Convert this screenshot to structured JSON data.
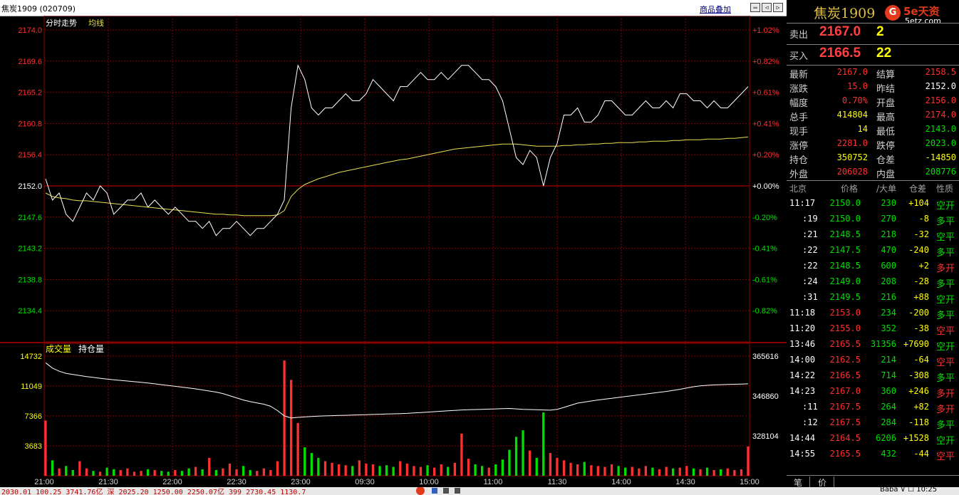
{
  "header": {
    "title": "焦炭1909 (020709)",
    "overlay_link": "商品叠加"
  },
  "chart_labels": {
    "tick_legend": "分时走势",
    "avg_legend": "均线",
    "volume_legend": "成交量",
    "oi_legend": "持仓量"
  },
  "colors": {
    "up": "#ff3030",
    "down": "#00e000",
    "flat": "#ffffff",
    "grid": "#8b0000",
    "price_line": "#ffffff",
    "avg_line": "#e8e050",
    "volume_label": "#ffff00"
  },
  "chart_data": {
    "type": "line",
    "price_axis": {
      "ticks": [
        "2174.0",
        "2169.6",
        "2165.2",
        "2160.8",
        "2156.4",
        "2152.0",
        "2147.6",
        "2143.2",
        "2138.8",
        "2134.4"
      ],
      "pct_ticks": [
        "+1.02%",
        "+0.82%",
        "+0.61%",
        "+0.41%",
        "+0.20%",
        "+0.00%",
        "-0.20%",
        "-0.41%",
        "-0.61%",
        "-0.82%"
      ],
      "prev_settle": 2152.0,
      "ylim": [
        2130.0,
        2174.0
      ]
    },
    "volume_axis": {
      "ticks": [
        "14732",
        "11049",
        "7366",
        "3683"
      ],
      "oi_ticks": [
        "365616",
        "346860",
        "328104"
      ],
      "ylim": [
        0,
        14732
      ],
      "oi_lim": [
        309348,
        365616
      ]
    },
    "time_labels": [
      "21:00",
      "21:30",
      "22:00",
      "22:30",
      "23:00",
      "09:30",
      "10:00",
      "11:00",
      "11:30",
      "14:00",
      "14:30",
      "15:00"
    ],
    "price": [
      2153,
      2150,
      2151,
      2148,
      2147,
      2149,
      2151,
      2150,
      2152,
      2151,
      2148,
      2149,
      2150,
      2150,
      2151,
      2149,
      2150,
      2149,
      2148,
      2149,
      2148,
      2147,
      2147,
      2146,
      2147,
      2145,
      2146,
      2146,
      2147,
      2146,
      2145,
      2146,
      2146,
      2147,
      2148,
      2150,
      2163,
      2169,
      2167,
      2163,
      2162,
      2163,
      2163,
      2164,
      2165,
      2164,
      2164,
      2165,
      2167,
      2166,
      2165,
      2164,
      2166,
      2166,
      2167,
      2168,
      2167,
      2167,
      2168,
      2167,
      2168,
      2169,
      2169,
      2168,
      2167,
      2167,
      2166,
      2164,
      2160,
      2156,
      2155,
      2157,
      2156,
      2152,
      2156,
      2158,
      2162,
      2162,
      2163,
      2161,
      2161,
      2162,
      2164,
      2164,
      2163,
      2162,
      2162,
      2163,
      2164,
      2163,
      2163,
      2164,
      2163,
      2165,
      2165,
      2164,
      2164,
      2163,
      2164,
      2163,
      2163,
      2164,
      2165,
      2166
    ],
    "avg": [
      2151,
      2150.5,
      2150.3,
      2150.2,
      2150.0,
      2149.9,
      2149.9,
      2149.8,
      2149.7,
      2149.6,
      2149.5,
      2149.4,
      2149.3,
      2149.2,
      2149.1,
      2149.0,
      2148.9,
      2148.8,
      2148.7,
      2148.6,
      2148.5,
      2148.4,
      2148.3,
      2148.2,
      2148.1,
      2148.0,
      2148.0,
      2147.9,
      2147.9,
      2147.8,
      2147.8,
      2147.8,
      2147.8,
      2147.8,
      2147.9,
      2148.5,
      2150.5,
      2151.5,
      2152.2,
      2152.6,
      2153.0,
      2153.3,
      2153.6,
      2153.9,
      2154.1,
      2154.3,
      2154.5,
      2154.7,
      2154.9,
      2155.1,
      2155.3,
      2155.5,
      2155.7,
      2155.8,
      2156.0,
      2156.2,
      2156.4,
      2156.6,
      2156.8,
      2157.0,
      2157.2,
      2157.3,
      2157.4,
      2157.5,
      2157.6,
      2157.7,
      2157.8,
      2157.9,
      2157.9,
      2157.9,
      2157.8,
      2157.7,
      2157.6,
      2157.6,
      2157.6,
      2157.6,
      2157.7,
      2157.7,
      2157.8,
      2157.8,
      2157.9,
      2157.9,
      2158.0,
      2158.0,
      2158.1,
      2158.1,
      2158.1,
      2158.2,
      2158.2,
      2158.3,
      2158.3,
      2158.3,
      2158.4,
      2158.4,
      2158.5,
      2158.5,
      2158.5,
      2158.6,
      2158.6,
      2158.6,
      2158.7,
      2158.7,
      2158.8,
      2158.9
    ],
    "volume": [
      6800,
      1900,
      900,
      1200,
      700,
      1800,
      900,
      600,
      500,
      1000,
      800,
      700,
      900,
      500,
      600,
      800,
      700,
      600,
      500,
      700,
      600,
      900,
      1100,
      800,
      2200,
      700,
      900,
      1500,
      800,
      1200,
      700,
      600,
      900,
      700,
      1800,
      14200,
      11800,
      6500,
      3500,
      2800,
      2200,
      1800,
      1600,
      1400,
      1300,
      1200,
      1900,
      1500,
      1400,
      1200,
      1300,
      1100,
      1800,
      1500,
      1200,
      1100,
      1300,
      1000,
      1400,
      1100,
      1600,
      5200,
      2100,
      1400,
      1200,
      1000,
      1400,
      2000,
      3200,
      4800,
      5600,
      3100,
      2200,
      7800,
      2800,
      2200,
      1900,
      1600,
      1400,
      1700,
      1300,
      1200,
      1100,
      1400,
      1200,
      1000,
      1100,
      900,
      1200,
      1000,
      800,
      1100,
      900,
      1000,
      1200,
      900,
      800,
      1000,
      700,
      800,
      900,
      700,
      800,
      3600
    ],
    "open_interest": [
      362500,
      360000,
      358500,
      357500,
      357000,
      356500,
      356000,
      355600,
      355200,
      354800,
      354500,
      354200,
      353900,
      353600,
      353300,
      353000,
      352600,
      352200,
      351800,
      351400,
      351000,
      350600,
      350200,
      349700,
      349200,
      348700,
      348000,
      347000,
      346000,
      345000,
      344200,
      343600,
      343000,
      342000,
      340000,
      337500,
      336500,
      336800,
      337000,
      337200,
      337400,
      337500,
      337600,
      337700,
      337800,
      337900,
      338000,
      338100,
      338200,
      338300,
      338400,
      338500,
      338600,
      338700,
      338900,
      339100,
      339300,
      339500,
      339700,
      339900,
      340100,
      340300,
      340400,
      340500,
      340600,
      340700,
      340800,
      340900,
      341000,
      340800,
      340600,
      340500,
      340400,
      340300,
      340200,
      340600,
      341500,
      342500,
      343500,
      344000,
      344500,
      345000,
      345400,
      345800,
      346200,
      346600,
      347000,
      347400,
      347800,
      348200,
      348600,
      349000,
      349500,
      350000,
      350600,
      351200,
      351600,
      351900,
      352100,
      352200,
      352300,
      352400,
      352500,
      352600
    ]
  },
  "order_book": {
    "ask_label": "卖出",
    "ask_price": "2167.0",
    "ask_vol": "2",
    "bid_label": "买入",
    "bid_price": "2166.5",
    "bid_vol": "22"
  },
  "quote": {
    "contract": "焦炭1909",
    "rows": [
      {
        "l1": "最新",
        "v1": "2167.0",
        "c1": "up",
        "l2": "结算",
        "v2": "2158.5",
        "c2": "up"
      },
      {
        "l1": "涨跌",
        "v1": "15.0",
        "c1": "up",
        "l2": "昨结",
        "v2": "2152.0",
        "c2": "flat"
      },
      {
        "l1": "幅度",
        "v1": "0.70%",
        "c1": "up",
        "l2": "开盘",
        "v2": "2156.0",
        "c2": "up"
      },
      {
        "l1": "总手",
        "v1": "414804",
        "c1": "vol",
        "l2": "最高",
        "v2": "2174.0",
        "c2": "up"
      },
      {
        "l1": "现手",
        "v1": "14",
        "c1": "vol",
        "l2": "最低",
        "v2": "2143.0",
        "c2": "down"
      },
      {
        "l1": "涨停",
        "v1": "2281.0",
        "c1": "up",
        "l2": "跌停",
        "v2": "2023.0",
        "c2": "down"
      },
      {
        "l1": "持仓",
        "v1": "350752",
        "c1": "vol",
        "l2": "仓差",
        "v2": "-14850",
        "c2": "vol"
      },
      {
        "l1": "外盘",
        "v1": "206028",
        "c1": "up",
        "l2": "内盘",
        "v2": "208776",
        "c2": "down"
      }
    ]
  },
  "ticks": {
    "headers": {
      "time": "北京",
      "price": "价格",
      "vol": "/大单",
      "oi": "仓差",
      "nature": "性质"
    },
    "rows": [
      {
        "time": "11:17",
        "price": "2150.0",
        "pc": "down",
        "vol": "230",
        "oi": "+104",
        "nature": "空开",
        "nc": "down"
      },
      {
        "time": ":19",
        "price": "2150.0",
        "pc": "down",
        "vol": "270",
        "oi": "-8",
        "nature": "多平",
        "nc": "down"
      },
      {
        "time": ":21",
        "price": "2148.5",
        "pc": "down",
        "vol": "218",
        "oi": "-32",
        "nature": "空平",
        "nc": "down"
      },
      {
        "time": ":22",
        "price": "2147.5",
        "pc": "down",
        "vol": "470",
        "oi": "-240",
        "nature": "多平",
        "nc": "down"
      },
      {
        "time": ":22",
        "price": "2148.5",
        "pc": "down",
        "vol": "600",
        "oi": "+2",
        "nature": "多开",
        "nc": "up"
      },
      {
        "time": ":24",
        "price": "2149.0",
        "pc": "down",
        "vol": "208",
        "oi": "-28",
        "nature": "多平",
        "nc": "down"
      },
      {
        "time": ":31",
        "price": "2149.5",
        "pc": "down",
        "vol": "216",
        "oi": "+88",
        "nature": "空开",
        "nc": "down"
      },
      {
        "time": "11:18",
        "price": "2153.0",
        "pc": "up",
        "vol": "234",
        "oi": "-200",
        "nature": "多平",
        "nc": "down"
      },
      {
        "time": "11:20",
        "price": "2155.0",
        "pc": "up",
        "vol": "352",
        "oi": "-38",
        "nature": "空平",
        "nc": "up"
      },
      {
        "time": "13:46",
        "price": "2165.5",
        "pc": "up",
        "vol": "31356",
        "oi": "+7690",
        "nature": "空开",
        "nc": "down"
      },
      {
        "time": "14:00",
        "price": "2162.5",
        "pc": "up",
        "vol": "214",
        "oi": "-64",
        "nature": "空平",
        "nc": "up"
      },
      {
        "time": "14:22",
        "price": "2166.5",
        "pc": "up",
        "vol": "714",
        "oi": "-308",
        "nature": "多平",
        "nc": "down"
      },
      {
        "time": "14:23",
        "price": "2167.0",
        "pc": "up",
        "vol": "360",
        "oi": "+246",
        "nature": "多开",
        "nc": "up"
      },
      {
        "time": ":11",
        "price": "2167.5",
        "pc": "up",
        "vol": "264",
        "oi": "+82",
        "nature": "多开",
        "nc": "up"
      },
      {
        "time": ":12",
        "price": "2167.5",
        "pc": "up",
        "vol": "284",
        "oi": "-118",
        "nature": "多平",
        "nc": "down"
      },
      {
        "time": "14:44",
        "price": "2164.5",
        "pc": "up",
        "vol": "6206",
        "oi": "+1528",
        "nature": "空开",
        "nc": "down"
      },
      {
        "time": "14:55",
        "price": "2165.5",
        "pc": "up",
        "vol": "432",
        "oi": "-44",
        "nature": "空平",
        "nc": "up"
      }
    ]
  },
  "bottom_tabs": [
    "笔",
    "价"
  ],
  "logo": {
    "name": "5e天资",
    "url": "5etz.com"
  },
  "statusbar": {
    "left_text": "2030.01   100.25   3741.76亿   深   2025.20   1250.00   2250.07亿   399   2730.45   1130.7",
    "right_text": "Baba  ⊽ ☐   10:25"
  }
}
